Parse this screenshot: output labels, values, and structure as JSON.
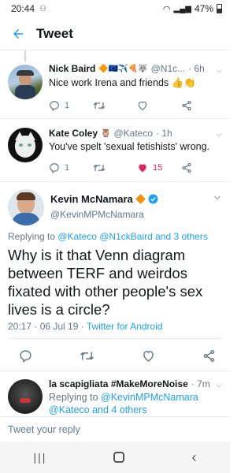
{
  "status_bar": {
    "time": "20:44",
    "battery": "47%"
  },
  "header": {
    "title": "Tweet"
  },
  "tweets": [
    {
      "name": "Nick Baird",
      "emojis": "🔶🇪🇺✈️🍕🐺",
      "handle": "@N1c...",
      "time": "· 6h",
      "text": "Nice work Irena and friends 👍👏",
      "replies": "1",
      "retweets": "",
      "likes": ""
    },
    {
      "name": "Kate Coley",
      "emojis": "🦉",
      "handle": "@Kateco",
      "time": "· 1h",
      "text": "You've spelt 'sexual fetishists' wrong.",
      "replies": "1",
      "retweets": "",
      "likes": "15"
    }
  ],
  "main_tweet": {
    "name": "Kevin McNamara",
    "handle": "@KevinMPMcNamara",
    "replying_prefix": "Replying to ",
    "replying_to": "@Kateco @N1ckBaird and 3 others",
    "text": "Why is it that Venn diagram between TERF and weirdos fixated with other people's sex lives is a circle?",
    "timestamp": "20:17 · 06 Jul 19 · ",
    "source": "Twitter for Android"
  },
  "reply_tweet": {
    "name": "la scapigliata #MakeMoreNoise",
    "time": "· 7m",
    "replying_prefix": "Replying to ",
    "replying_line1": "@KevinMPMcNamara",
    "replying_line2": "@Kateco and 4 others"
  },
  "reply_input": {
    "placeholder": "Tweet your reply"
  },
  "colors": {
    "accent": "#1da1f2",
    "like": "#e0245e"
  }
}
